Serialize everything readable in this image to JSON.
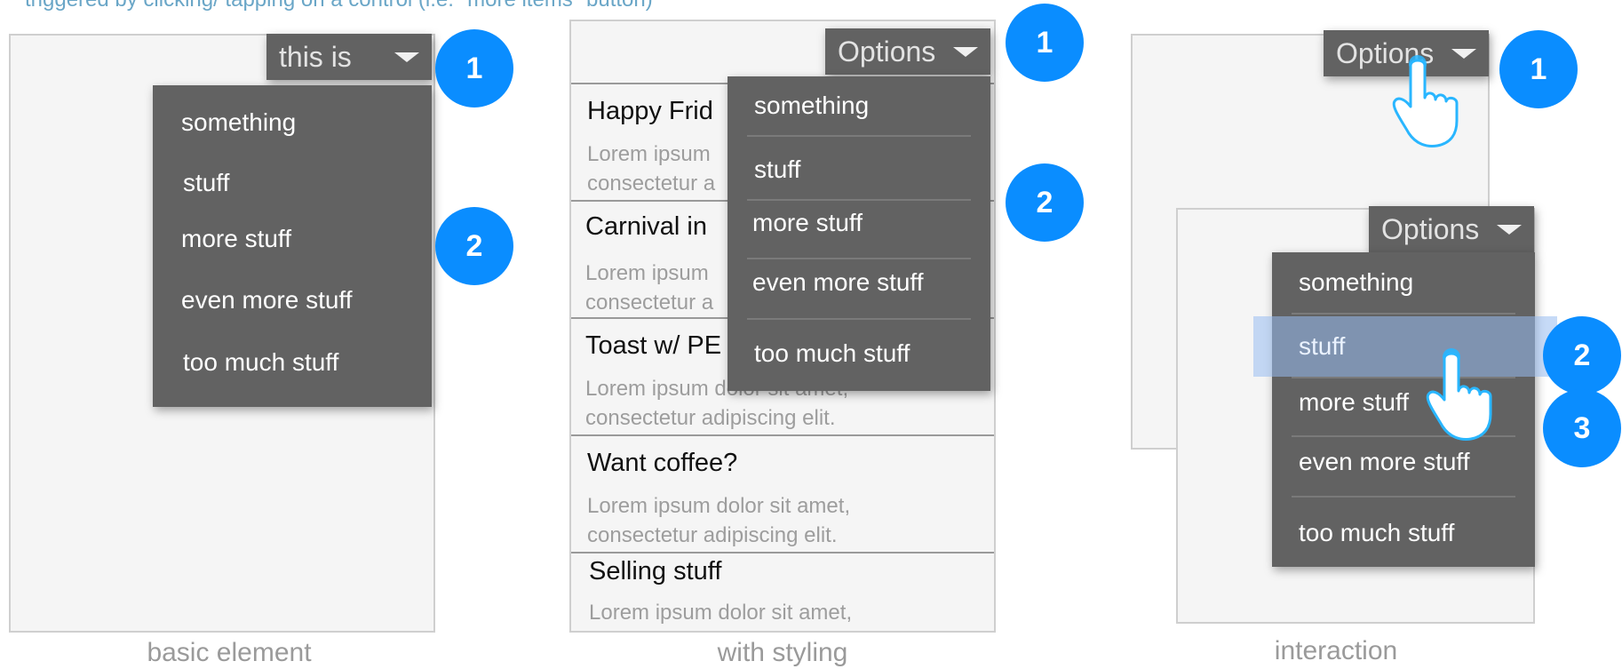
{
  "intro_text": "triggered by clicking/ tapping on a control (i.e. \"more items\" button)",
  "colors": {
    "panel": "#f5f5f5",
    "menu": "#626262",
    "badge": "#0a8dff",
    "highlight": "#98bcf0",
    "touch": "#29b6ff"
  },
  "icons": {
    "caret": "caret-down-icon",
    "hand": "hand-pointer-icon"
  },
  "basic": {
    "caption": "basic element",
    "button_label": "this is",
    "menu_items": [
      "something",
      "stuff",
      "more stuff",
      "even more stuff",
      "too much stuff"
    ],
    "badges": [
      "1",
      "2"
    ]
  },
  "styling": {
    "caption": "with styling",
    "button_label": "Options",
    "menu_items": [
      "something",
      "stuff",
      "more stuff",
      "even more stuff",
      "too much stuff"
    ],
    "badges": [
      "1",
      "2"
    ],
    "list": [
      {
        "title": "Happy Frid",
        "body": [
          "Lorem ipsum",
          "consectetur a"
        ]
      },
      {
        "title": "Carnival in",
        "body": [
          "Lorem ipsum",
          "consectetur a"
        ]
      },
      {
        "title": "Toast w/ PE",
        "body": [
          "Lorem ipsum dolor sit amet,",
          "consectetur adipiscing elit."
        ]
      },
      {
        "title": "Want coffee?",
        "body": [
          "Lorem ipsum dolor sit amet,",
          "consectetur adipiscing elit."
        ]
      },
      {
        "title": "Selling stuff",
        "body": [
          "Lorem ipsum dolor sit amet,"
        ]
      }
    ]
  },
  "interaction": {
    "caption": "interaction",
    "back_button_label": "Options",
    "front_button_label": "Options",
    "menu_items": [
      "something",
      "stuff",
      "more stuff",
      "even more stuff",
      "too much stuff"
    ],
    "highlighted_item": "stuff",
    "badges": [
      "1",
      "2",
      "3"
    ]
  }
}
